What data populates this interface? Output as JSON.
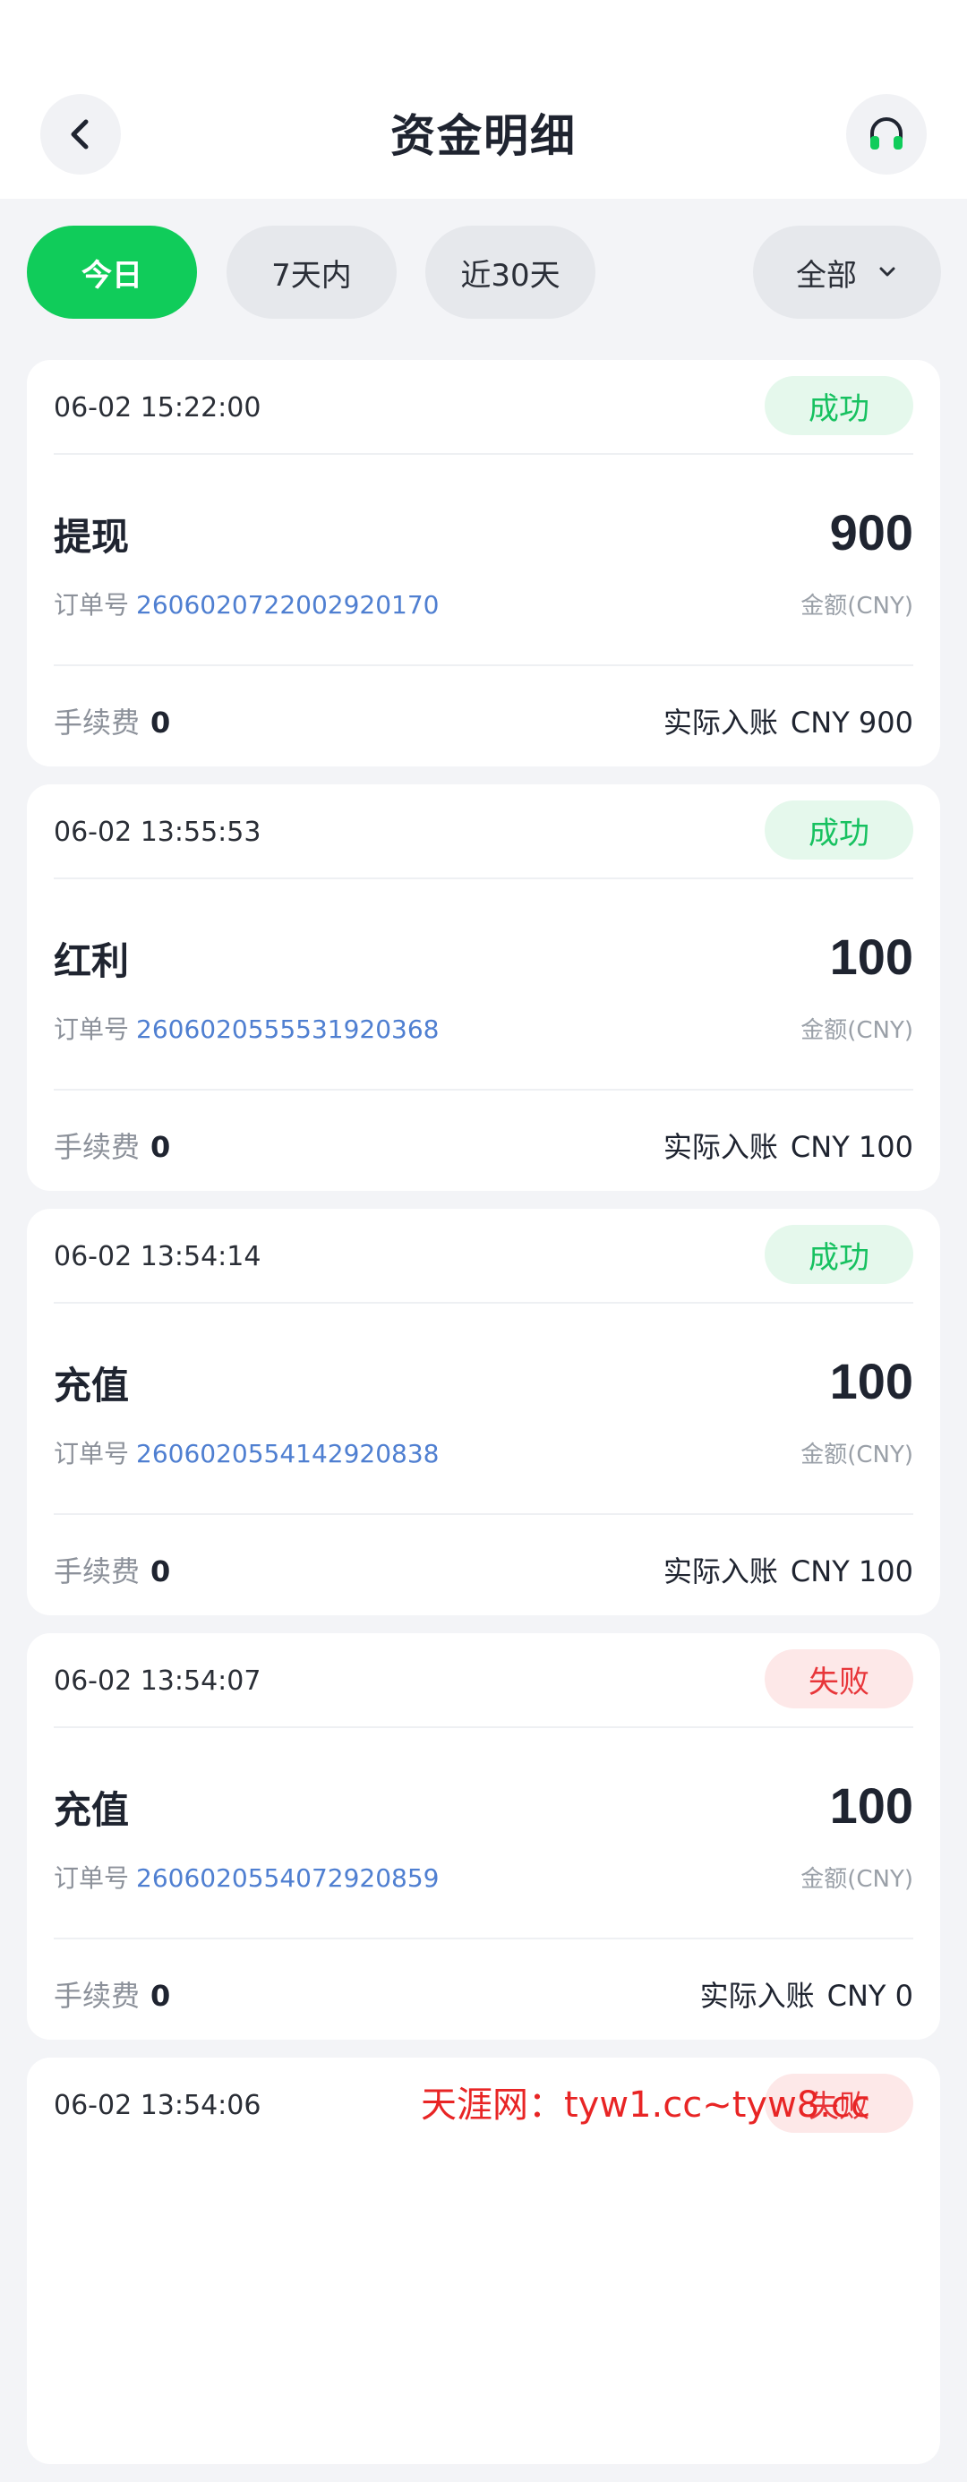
{
  "header": {
    "title": "资金明细",
    "back_icon": "chevron-left-icon",
    "service_icon": "headset-icon"
  },
  "filters": {
    "tabs": [
      "今日",
      "7天内",
      "近30天"
    ],
    "active_tab": "今日",
    "dropdown_label": "全部"
  },
  "labels": {
    "order_prefix": "订单号",
    "currency_caption": "金额(CNY)",
    "fee_label": "手续费",
    "credit_label": "实际入账"
  },
  "records": [
    {
      "time": "06-02 15:22:00",
      "status": "成功",
      "status_type": "success",
      "type": "提现",
      "amount": "900",
      "order_no": "2606020722002920170",
      "fee": "0",
      "credited": "CNY 900"
    },
    {
      "time": "06-02 13:55:53",
      "status": "成功",
      "status_type": "success",
      "type": "红利",
      "amount": "100",
      "order_no": "2606020555531920368",
      "fee": "0",
      "credited": "CNY 100"
    },
    {
      "time": "06-02 13:54:14",
      "status": "成功",
      "status_type": "success",
      "type": "充值",
      "amount": "100",
      "order_no": "2606020554142920838",
      "fee": "0",
      "credited": "CNY 100"
    },
    {
      "time": "06-02 13:54:07",
      "status": "失败",
      "status_type": "failed",
      "type": "充值",
      "amount": "100",
      "order_no": "2606020554072920859",
      "fee": "0",
      "credited": "CNY 0"
    },
    {
      "time": "06-02 13:54:06",
      "status": "失败",
      "status_type": "failed"
    }
  ],
  "watermark": {
    "brand": "天涯网：",
    "site": "tyw1.cc~tyw8.cc"
  },
  "colors": {
    "accent": "#10cc5a",
    "success": "#17c160",
    "failed": "#e8363a",
    "order_link": "#4f7fd1"
  }
}
